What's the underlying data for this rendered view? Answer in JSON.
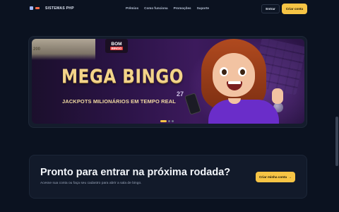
{
  "header": {
    "brand": "SISTEMAS PHP",
    "nav": [
      "Prêmios",
      "Como funciona",
      "Promoções",
      "Suporte"
    ],
    "login_label": "Entrar",
    "create_label": "Criar conta"
  },
  "banner": {
    "logo_top": "BOM",
    "logo_bottom": "BINGO",
    "money_text": "200",
    "title": "MEGA BINGO",
    "subtitle": "JACKPOTS MILIONÁRIOS EM TEMPO REAL",
    "ball_number": "27",
    "slides_total": 3,
    "active_slide": 1
  },
  "cta": {
    "title": "Pronto para entrar na próxima rodada?",
    "subtitle": "Acesse sua conta ou faça seu cadastro para abrir a sala de bingo.",
    "button_label": "Criar minha conta",
    "button_arrow": "→"
  },
  "colors": {
    "background": "#0b1220",
    "accent": "#f6c445",
    "banner_purple": "#3c1a5c"
  }
}
